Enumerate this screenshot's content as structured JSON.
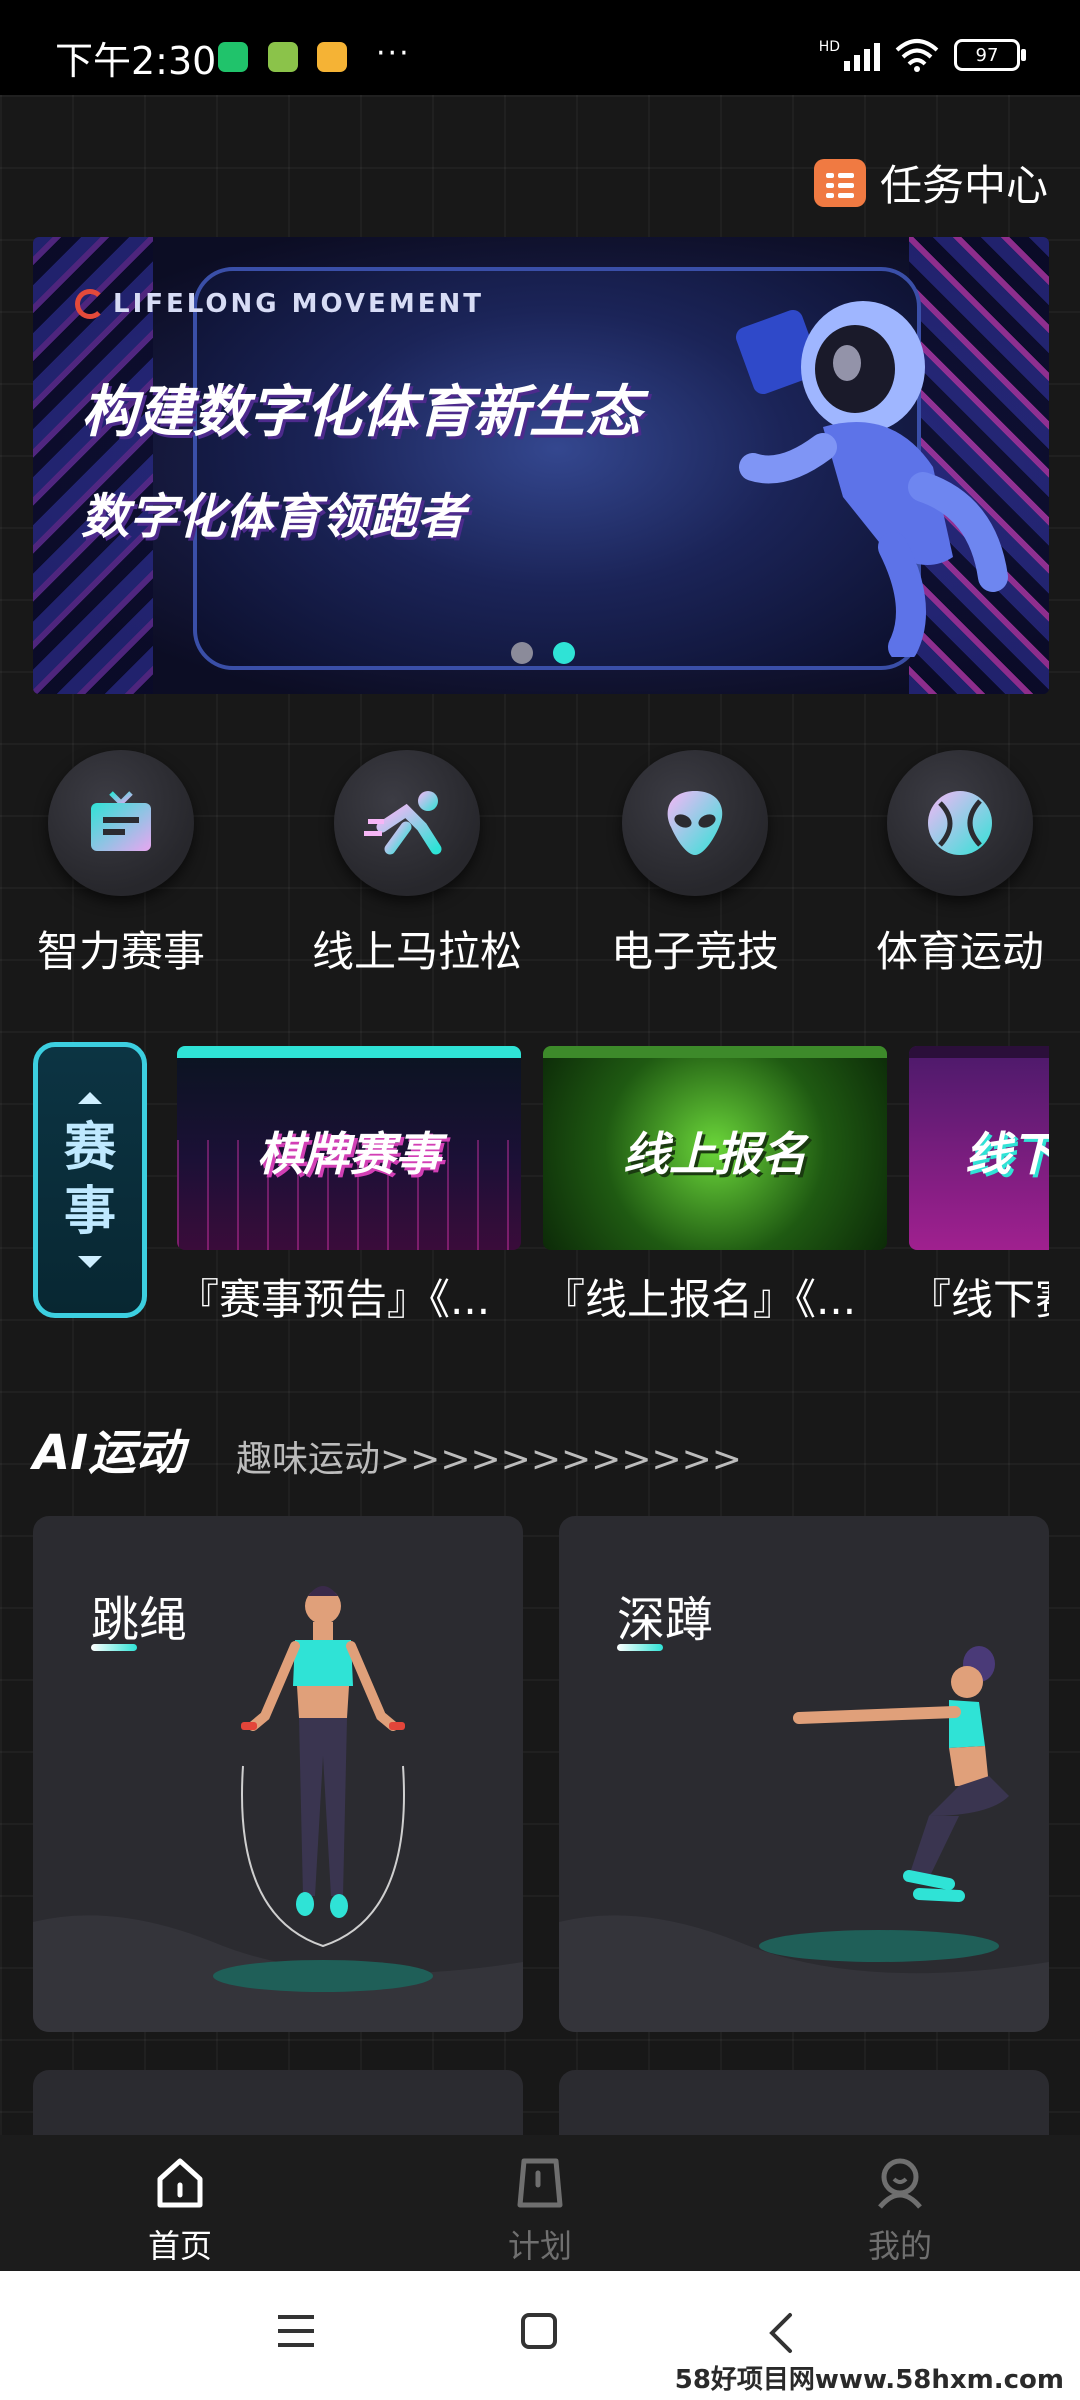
{
  "status_bar": {
    "time": "下午2:30",
    "more": "···",
    "battery": "97",
    "network": "HD"
  },
  "header": {
    "task_center_label": "任务中心"
  },
  "banner": {
    "brand": "LIFELONG MOVEMENT",
    "title": "构建数字化体育新生态",
    "subtitle": "数字化体育领跑者",
    "page_count": 2,
    "active_page": 2
  },
  "categories": [
    {
      "label": "智力赛事",
      "icon": "puzzle-card-icon"
    },
    {
      "label": "线上马拉松",
      "icon": "runner-icon"
    },
    {
      "label": "电子竞技",
      "icon": "alien-icon"
    },
    {
      "label": "体育运动",
      "icon": "ball-icon"
    }
  ],
  "events": {
    "tag": [
      "赛",
      "事"
    ],
    "cards": [
      {
        "thumb_text": "棋牌赛事",
        "title": "『赛事预告』《..."
      },
      {
        "thumb_text": "线上报名",
        "title": "『线上报名』《..."
      },
      {
        "thumb_text": "线下",
        "title": "『线下赛"
      }
    ]
  },
  "ai_section": {
    "title": "AI运动",
    "subtitle": "趣味运动>>>>>>>>>>>>",
    "cards": [
      {
        "name": "跳绳"
      },
      {
        "name": "深蹲"
      }
    ]
  },
  "bottom_nav": {
    "items": [
      {
        "label": "首页",
        "active": true
      },
      {
        "label": "计划",
        "active": false
      },
      {
        "label": "我的",
        "active": false
      }
    ]
  },
  "watermark": "58好项目网www.58hxm.com",
  "colors": {
    "accent": "#2fe3d6",
    "task_icon": "#f07a42",
    "card_bg": "#2b2b30"
  }
}
